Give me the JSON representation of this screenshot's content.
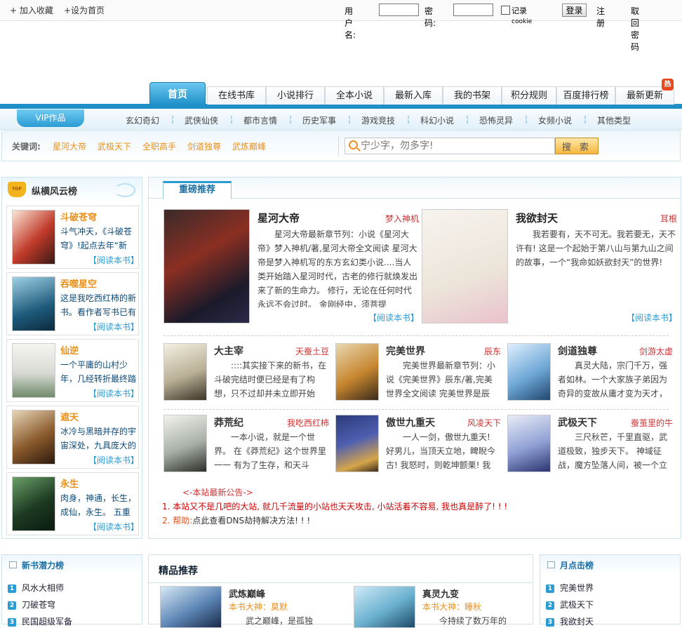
{
  "topbar": {
    "favorite": "+ 加入收藏",
    "sethome": "+设为首页"
  },
  "login": {
    "user_label": "用户名:",
    "pass_label": "密 码:",
    "remember": "记录",
    "remember_small": "cookie",
    "login_btn": "登录",
    "register": "注册",
    "forgot": "取回密码"
  },
  "nav": {
    "tabs": [
      "首页",
      "在线书库",
      "小说排行",
      "全本小说",
      "最新入库",
      "我的书架",
      "积分规则",
      "百度排行榜",
      "最新更新"
    ],
    "hot": "热"
  },
  "subnav": {
    "vip": "VIP作品",
    "items": [
      "玄幻奇幻",
      "武侠仙侠",
      "都市言情",
      "历史军事",
      "游戏竞技",
      "科幻小说",
      "恐怖灵异",
      "女频小说",
      "其他类型"
    ]
  },
  "keywords": {
    "label": "关键词:",
    "items": [
      "星河大帝",
      "武极天下",
      "全职高手",
      "剑道独尊",
      "武炼巅峰"
    ]
  },
  "search": {
    "placeholder": "宁少字，勿多字!",
    "button": "搜 索"
  },
  "left": {
    "title": "纵横风云榜",
    "badge": "TOP",
    "books": [
      {
        "title": "斗破苍穹",
        "desc": "斗气冲天，《斗破苍穹》!起点去年“新",
        "read": "【阅读本书】",
        "cover_text": "斗破苍穹"
      },
      {
        "title": "吞噬星空",
        "desc": "这是我吃西红柿的新书。看作者写书已有",
        "read": "【阅读本书】",
        "cover_text": "吞噬星空"
      },
      {
        "title": "仙逆",
        "desc": "一个平庸的山村少年，几经转折最终踏",
        "read": "【阅读本书】",
        "cover_text": "仙逆"
      },
      {
        "title": "遮天",
        "desc": "冰冷与黑暗并存的宇宙深处，九具庞大的",
        "read": "【阅读本书】",
        "cover_text": "遮天"
      },
      {
        "title": "永生",
        "desc": "肉身，神通，长生，成仙，永生。 五重",
        "read": "【阅读本书】",
        "cover_text": "永生"
      }
    ]
  },
  "main": {
    "tab": "重磅推荐",
    "featured": [
      {
        "title": "星河大帝",
        "author": "梦入神机",
        "desc": "星河大帝最新章节列：小说《星河大帝》梦入神机/著,星河大帝全文阅读 星河大帝是梦入神机写的东方玄幻类小说....当人类开始踏入星河时代，古老的修行就焕发出来了新的生命力。 修行，无论在任何时代永远不会过时。 金刚经中，须菩提",
        "read": "【阅读本书】",
        "cover_text": "星河大帝"
      },
      {
        "title": "我欲封天",
        "author": "耳根",
        "desc": "我若要有，天不可无。我若要无，天不许有! 这是一个起始于第八山与第九山之间的故事，一个“我命如妖欲封天”的世界!",
        "read": "【阅读本书】",
        "cover_text": "耳根"
      }
    ],
    "books": [
      {
        "title": "大主宰",
        "author": "天蚕土豆",
        "desc": "::::其实接下来的新书，在斗破完结时便已经是有了构想，只不过却并未立即开始",
        "cover_text": "大主宰"
      },
      {
        "title": "完美世界",
        "author": "辰东",
        "desc": "完美世界最新章节列：小说《完美世界》辰东/著,完美世界全文阅读 完美世界是辰",
        "cover_text": "完美世界"
      },
      {
        "title": "剑道独尊",
        "author": "剑游太虚",
        "desc": "真灵大陆，宗门千万，强者如林。一个大家族子弟因为奇异的变故从庸才变为天才，",
        "cover_text": "剑道独尊"
      },
      {
        "title": "莽荒纪",
        "author": "我吃西红柿",
        "desc": "一本小说，就是一个世界。 在《莽荒纪》这个世界里一一 有为了生存，和天斗",
        "cover_text": "莽荒纪"
      },
      {
        "title": "傲世九重天",
        "author": "风凌天下",
        "desc": "一人一剑，傲世九重天! 好男儿，当顶天立地，睥睨今古! 我怒时，则乾坤颤栗! 我",
        "cover_text": "傲世九重天"
      },
      {
        "title": "武极天下",
        "author": "蚕茧里的牛",
        "desc": "三尺秋芒，千里直驱，武道极致，独步天下。 神域征战，魔方坠落人间，被一个立",
        "cover_text": "武极天下"
      }
    ],
    "notice_title": "<-本站最新公告->",
    "notice1": "1. 本站又不是几吧的大站, 就几千流量的小站也天天攻击, 小站活着不容易, 我也真是醉了! ! !",
    "notice2_prefix": "2. ",
    "notice2_help": "帮助:",
    "notice2_text": "点此查看DNS劫持解决方法! ! !"
  },
  "bottom": {
    "left_title": "新书潜力榜",
    "left_items": [
      "风水大相师",
      "刀破苍穹",
      "民国超级军备"
    ],
    "center_title": "精品推荐",
    "center_books": [
      {
        "title": "武炼巅峰",
        "author": "本书大神：莫默",
        "desc": "武之巅峰，是孤独",
        "cover_text": "武炼巅峰"
      },
      {
        "title": "真灵九变",
        "author": "本书大神：睡秋",
        "desc": "今持续了数万年的",
        "cover_text": "真灵九变"
      }
    ],
    "right_title": "月点击榜",
    "right_items": [
      "完美世界",
      "武极天下",
      "我欲封天"
    ]
  },
  "colors": {
    "accent": "#2a9bd3",
    "orange": "#e8901a",
    "red": "#cc3333"
  }
}
